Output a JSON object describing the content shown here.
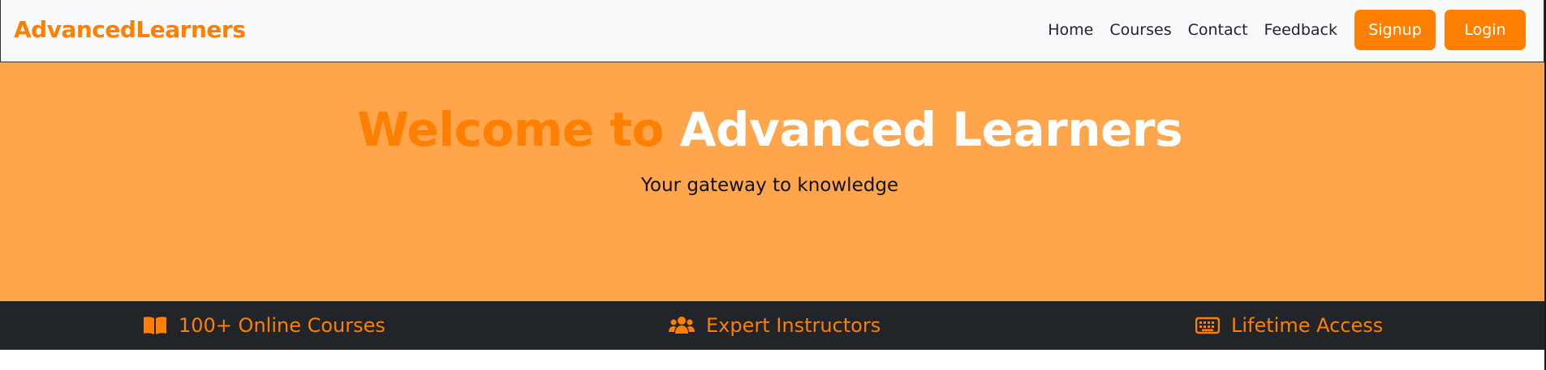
{
  "navbar": {
    "brand": "AdvancedLearners",
    "links": [
      {
        "label": "Home"
      },
      {
        "label": "Courses"
      },
      {
        "label": "Contact"
      },
      {
        "label": "Feedback"
      }
    ],
    "signup_label": "Signup",
    "login_label": "Login"
  },
  "hero": {
    "title_accent": "Welcome to",
    "title_main": "Advanced Learners",
    "subtitle": "Your gateway to knowledge"
  },
  "features": [
    {
      "icon": "book-open-icon",
      "label": "100+ Online Courses"
    },
    {
      "icon": "users-icon",
      "label": "Expert Instructors"
    },
    {
      "icon": "keyboard-icon",
      "label": "Lifetime Access"
    }
  ],
  "colors": {
    "accent": "#ff7f00",
    "hero_bg": "#ffa64d",
    "features_bg": "#212529",
    "navbar_bg": "#f8f9fa"
  }
}
